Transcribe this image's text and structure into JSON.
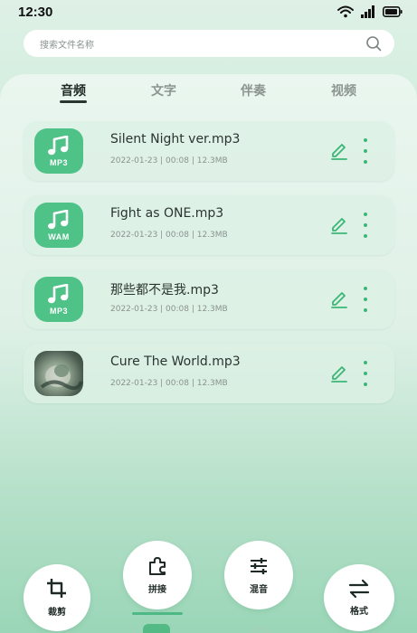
{
  "status_bar": {
    "time": "12:30",
    "icons": [
      "wifi-icon",
      "signal-icon",
      "battery-icon"
    ]
  },
  "search": {
    "placeholder": "搜索文件名称",
    "icon": "search-icon"
  },
  "tabs": [
    {
      "label": "音频",
      "active": true
    },
    {
      "label": "文字",
      "active": false
    },
    {
      "label": "伴奏",
      "active": false
    },
    {
      "label": "视频",
      "active": false
    }
  ],
  "files": [
    {
      "name": "Silent Night ver.mp3",
      "meta": "2022-01-23 | 00:08 | 12.3MB",
      "thumb": "music-note-icon",
      "format": "MP3"
    },
    {
      "name": "Fight as ONE.mp3",
      "meta": "2022-01-23 | 00:08 | 12.3MB",
      "thumb": "music-note-icon",
      "format": "WAM"
    },
    {
      "name": "那些都不是我.mp3",
      "meta": "2022-01-23 | 00:08 | 12.3MB",
      "thumb": "music-note-icon",
      "format": "MP3"
    },
    {
      "name": "Cure The World.mp3",
      "meta": "2022-01-23 | 00:08 | 12.3MB",
      "thumb": "album-cover-image",
      "format": ""
    }
  ],
  "toolbar": {
    "crop_label": "裁剪",
    "splice_label": "拼接",
    "mix_label": "混音",
    "format_label": "格式"
  },
  "colors": {
    "accent": "#4fc387",
    "accent_dark": "#3ab777",
    "text_primary": "#2a3530",
    "text_secondary": "#8a938e"
  }
}
